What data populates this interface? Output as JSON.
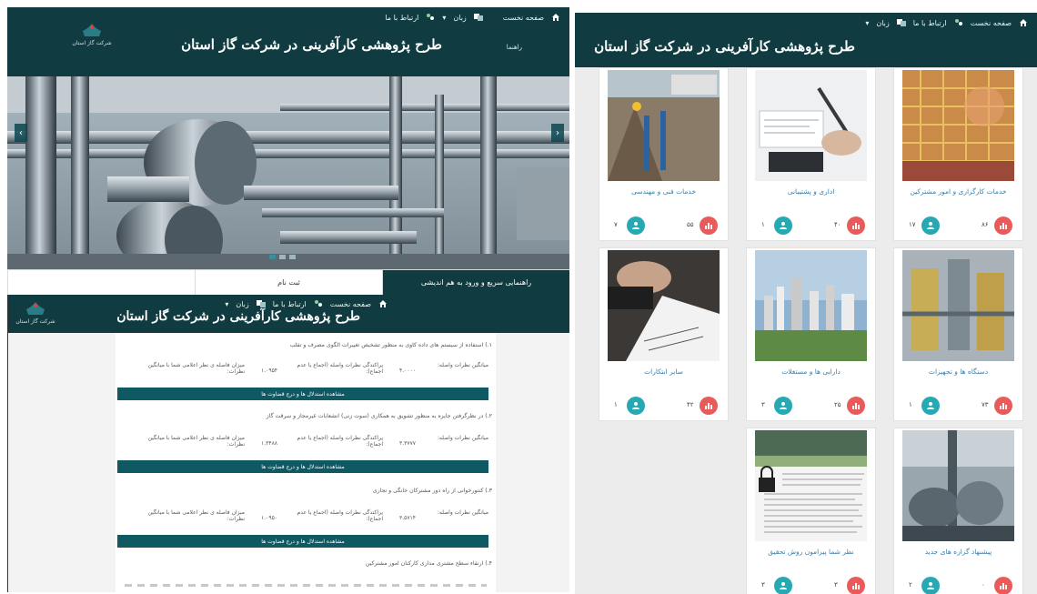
{
  "panel_a": {
    "nav": {
      "home": "صفحه نخست",
      "contact": "ارتباط با ما",
      "language": "زبان"
    },
    "title": "طرح پژوهشی کارآفرینی در شرکت گاز استان",
    "help": "راهنما",
    "logo_text": "شرکت گاز استان",
    "prev_icon": "‹",
    "next_icon": "›",
    "tabs": [
      {
        "label": "راهنمایی سریع و ورود به هم اندیشی",
        "active": true
      },
      {
        "label": "ثبت نام",
        "active": false
      },
      {
        "label": "",
        "active": false
      }
    ]
  },
  "panel_b": {
    "nav": {
      "home": "صفحه نخست",
      "contact": "ارتباط با ما",
      "language": "زبان"
    },
    "title": "طرح پژوهشی کارآفرینی در شرکت گاز استان",
    "logo_text": "شرکت گاز استان",
    "questions": [
      {
        "title": "۱.) استفاده از سیستم های داده کاوی به منظور تشخیص تغییرات الگوی مصرف و تقلب",
        "avg_label": "میانگین نظرات واصله:",
        "avg_value": "۴.۰۰۰۰",
        "dispersion_label": "پراکندگی نظرات واصله (اجماع یا عدم اجماع):",
        "dispersion_value": "۱.۰۹۵۴",
        "distance_label": "میزان فاصله ی نظر اعلامی شما با میانگین نظرات:",
        "button": "مشاهده استدلال ها و درج قضاوت ها"
      },
      {
        "title": "۲.) در نظرگرفتن جایزه به منظور تشویق به همکاری (سوت زنی) انشعابات غیرمجاز و سرقت گاز",
        "avg_label": "میانگین نظرات واصله:",
        "avg_value": "۳.۳۷۷۷",
        "dispersion_label": "پراکندگی نظرات واصله (اجماع یا عدم اجماع):",
        "dispersion_value": "۱.۳۴۸۸",
        "distance_label": "میزان فاصله ی نظر اعلامی شما با میانگین نظرات:",
        "button": "مشاهده استدلال ها و درج قضاوت ها"
      },
      {
        "title": "۳.) کنتورخوانی از راه دور مشترکان خانگی و تجاری",
        "avg_label": "میانگین نظرات واصله:",
        "avg_value": "۳.۵۷۱۴",
        "dispersion_label": "پراکندگی نظرات واصله (اجماع یا عدم اجماع):",
        "dispersion_value": "۱.۰۹۵۰",
        "distance_label": "میزان فاصله ی نظر اعلامی شما با میانگین نظرات:",
        "button": "مشاهده استدلال ها و درج قضاوت ها"
      },
      {
        "title": "۴.) ارتقاء سطح مشتری مداری کارکنان امور مشترکین",
        "avg_label": "",
        "avg_value": "",
        "dispersion_label": "",
        "dispersion_value": "",
        "distance_label": "",
        "button": ""
      }
    ]
  },
  "panel_c": {
    "nav": {
      "home": "صفحه نخست",
      "contact": "ارتباط با ما",
      "language": "زبان"
    },
    "title": "طرح پژوهشی کارآفرینی در شرکت گاز استان",
    "cards": [
      {
        "title": "خدمات کارگزاری و امور مشترکین",
        "left_count": "۸۶",
        "right_count": "۱۷"
      },
      {
        "title": "اداری و پشتیبانی",
        "left_count": "۴۰",
        "right_count": "۱"
      },
      {
        "title": "خدمات فنی و مهندسی",
        "left_count": "۵۵",
        "right_count": "۷"
      },
      {
        "title": "دستگاه ها و تجهیزات",
        "left_count": "۷۳",
        "right_count": "۱"
      },
      {
        "title": "دارایی ها و مستغلات",
        "left_count": "۲۵",
        "right_count": "۳"
      },
      {
        "title": "سایر ابتکارات",
        "left_count": "۴۲",
        "right_count": "۱"
      },
      {
        "title": "پیشنهاد گزاره های جدید",
        "left_count": "۰",
        "right_count": "۲"
      },
      {
        "title": "نظر شما پیرامون روش تحقیق",
        "left_count": "۳",
        "right_count": "۳"
      }
    ]
  },
  "colors": {
    "header": "#0f3b41",
    "button": "#0f5a62",
    "badge_red": "#e95b5b",
    "badge_teal": "#27a9b4",
    "link": "#3a7ea8"
  }
}
